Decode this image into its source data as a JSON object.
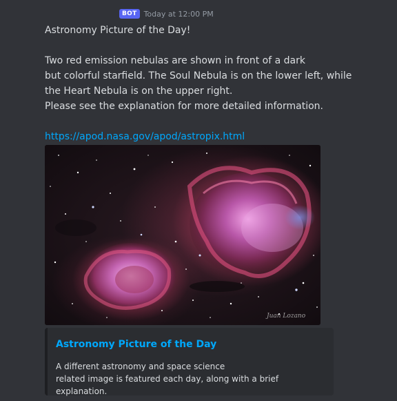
{
  "header": {
    "badge": "BOT",
    "timestamp": "Today at 12:00 PM"
  },
  "message": {
    "title_line": "Astronomy Picture of the Day!",
    "lines": [
      "Two red emission nebulas are shown in front of a dark",
      "but colorful starfield. The Soul Nebula is on the lower left, while",
      "the Heart Nebula is on the upper right.",
      "Please see the explanation for more detailed information."
    ],
    "link": "https://apod.nasa.gov/apod/astropix.html"
  },
  "image": {
    "icon": "nebula-photo",
    "signature": "Juan Lozano"
  },
  "embed": {
    "title": "Astronomy Picture of the Day",
    "description_lines": [
      "A different astronomy and space science",
      "related image is featured each day, along with a brief explanation."
    ]
  },
  "colors": {
    "background": "#313338",
    "link": "#00a8fc",
    "badge": "#5865f2",
    "embed_background": "#2b2d31"
  }
}
